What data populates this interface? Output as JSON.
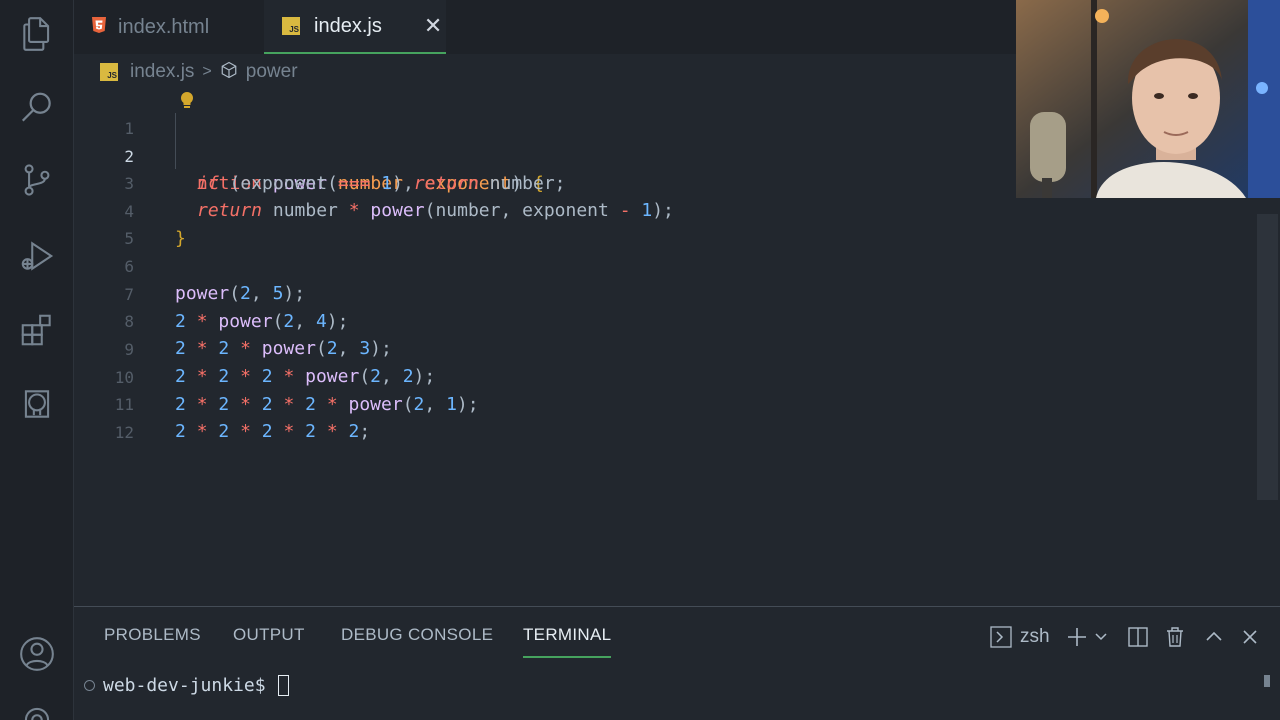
{
  "tabs": [
    {
      "label": "index.html",
      "icon": "html5-icon"
    },
    {
      "label": "index.js",
      "icon": "js-icon",
      "badge": "JS",
      "close": "✕"
    }
  ],
  "breadcrumb": {
    "file": "index.js",
    "badge": "JS",
    "separator": ">",
    "symbol": "power"
  },
  "editor": {
    "line_numbers": [
      "1",
      "2",
      "3",
      "4",
      "5",
      "6",
      "7",
      "8",
      "9",
      "10",
      "11",
      "12"
    ],
    "active_line": 2
  },
  "panel": {
    "tabs": [
      "PROBLEMS",
      "OUTPUT",
      "DEBUG CONSOLE",
      "TERMINAL"
    ],
    "active_tab": "TERMINAL",
    "shell": "zsh",
    "prompt": "web-dev-junkie$"
  },
  "colors": {
    "editor_bg": "#22272e",
    "accent_green": "#46a35e",
    "keyword": "#f47067",
    "function": "#dcbdfb",
    "param": "#f69d50",
    "number": "#6cb6ff"
  }
}
